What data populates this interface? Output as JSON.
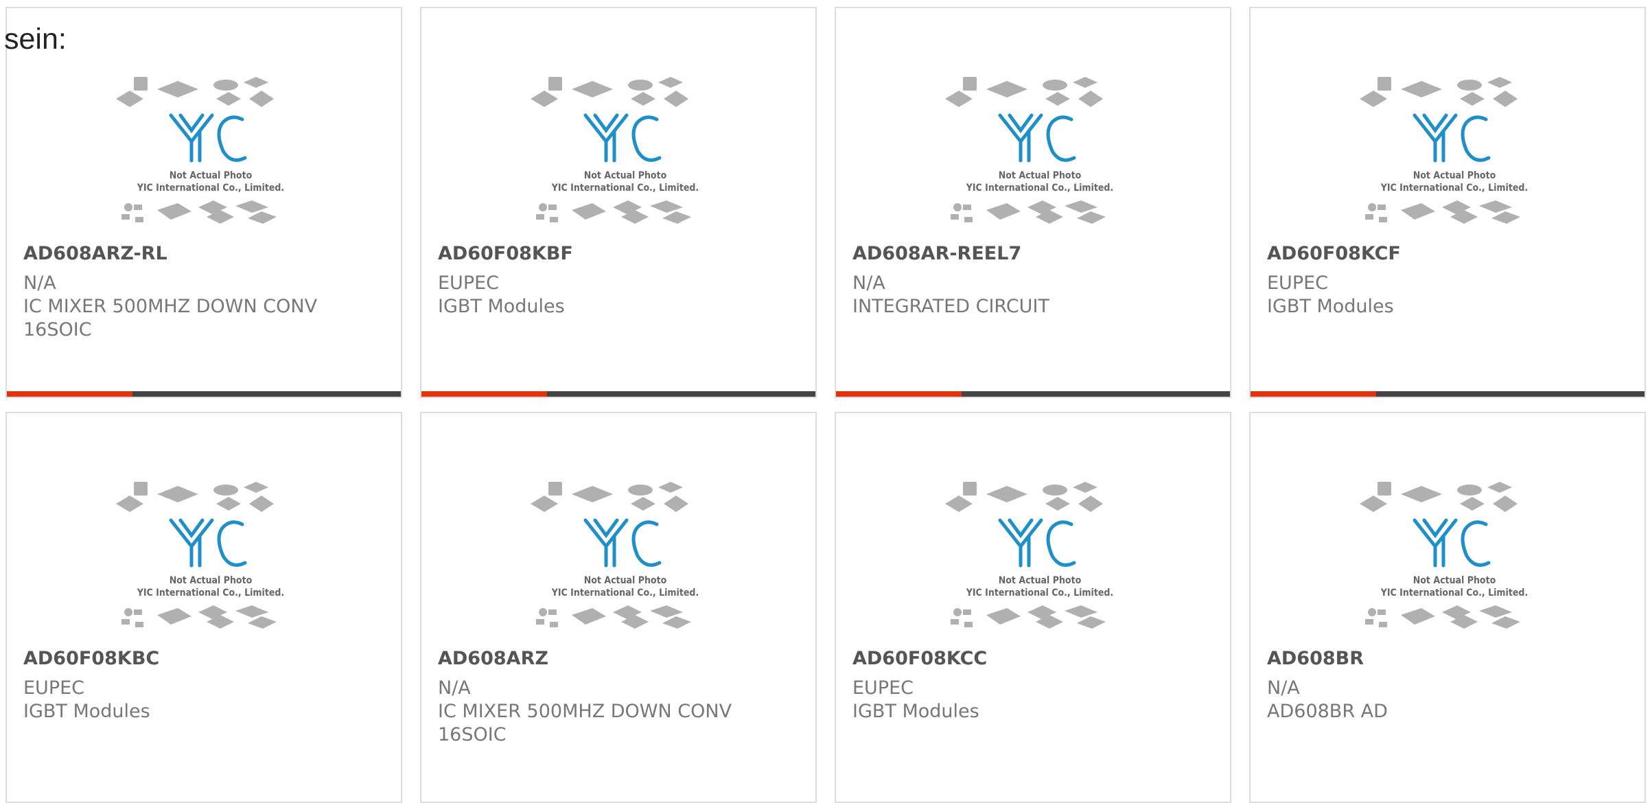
{
  "heading": "sein:",
  "image_caption": {
    "line1": "Not Actual Photo",
    "line2": "YIC International Co., Limited."
  },
  "logo_text": "YIC",
  "products": [
    {
      "part_number": "AD608ARZ-RL",
      "manufacturer": "N/A",
      "description": "IC MIXER 500MHZ DOWN CONV 16SOIC"
    },
    {
      "part_number": "AD60F08KBF",
      "manufacturer": "EUPEC",
      "description": "IGBT Modules"
    },
    {
      "part_number": "AD608AR-REEL7",
      "manufacturer": "N/A",
      "description": "INTEGRATED CIRCUIT"
    },
    {
      "part_number": "AD60F08KCF",
      "manufacturer": "EUPEC",
      "description": "IGBT Modules"
    },
    {
      "part_number": "AD60F08KBC",
      "manufacturer": "EUPEC",
      "description": "IGBT Modules"
    },
    {
      "part_number": "AD608ARZ",
      "manufacturer": "N/A",
      "description": "IC MIXER 500MHZ DOWN CONV 16SOIC"
    },
    {
      "part_number": "AD60F08KCC",
      "manufacturer": "EUPEC",
      "description": "IGBT Modules"
    },
    {
      "part_number": "AD608BR",
      "manufacturer": "N/A",
      "description": "AD608BR AD"
    }
  ],
  "colors": {
    "accent": "#e0340f",
    "bar": "#444444",
    "logo": "#1e8fc8"
  }
}
